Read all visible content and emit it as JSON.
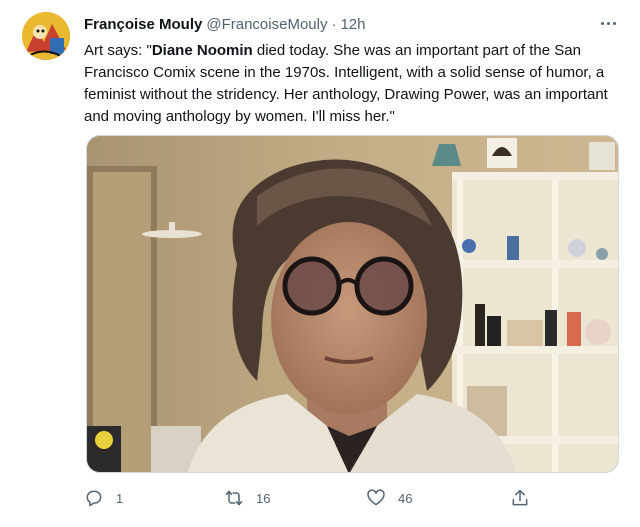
{
  "tweet": {
    "author": {
      "display_name": "Françoise Mouly",
      "handle": "@FrancoiseMouly",
      "separator": "·",
      "timestamp": "12h"
    },
    "text": {
      "part1": "Art says: \"",
      "bold": "Diane Noomin",
      "part2": " died today. She was an important part of the San Francisco Comix scene in the 1970s. Intelligent, with a solid sense of humor, a feminist without the stridency. Her anthology, Drawing Power, was an important and moving anthology by women.  I'll miss her.\""
    },
    "media": {
      "kind": "photo"
    },
    "actions": {
      "reply_count": "1",
      "retweet_count": "16",
      "like_count": "46"
    },
    "icons": {
      "reply": "reply-icon",
      "retweet": "retweet-icon",
      "like": "heart-icon",
      "share": "share-icon",
      "more": "more-icon"
    },
    "colors": {
      "text": "#0f1419",
      "secondary": "#536471",
      "border": "#cfd9de"
    }
  }
}
